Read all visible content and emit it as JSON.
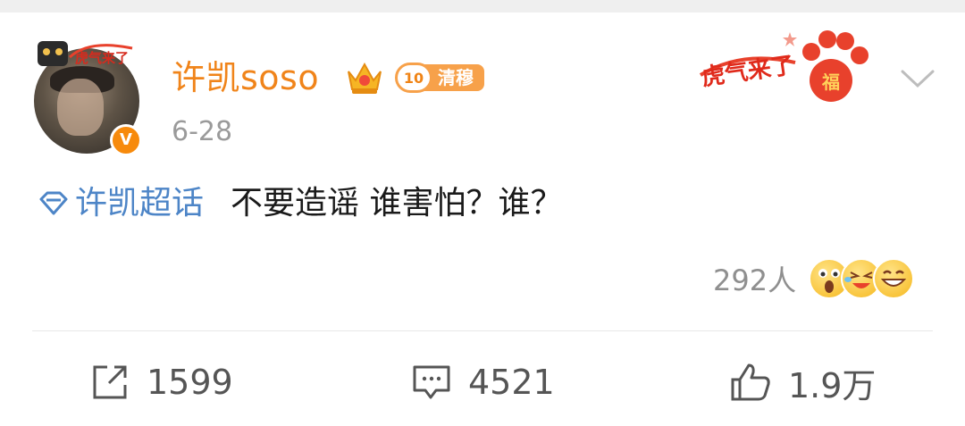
{
  "post": {
    "author": {
      "name": "许凯soso",
      "verified_mark": "V",
      "avatar_frame_text": "虎气来了",
      "crown_icon": "crown-icon",
      "fan_badge": {
        "level": "10",
        "name": "清穆"
      }
    },
    "date": "6-28",
    "content": {
      "topic_icon": "diamond-icon",
      "topic": "许凯超话",
      "text": "不要造谣 谁害怕？谁？"
    },
    "decoration": {
      "text": "虎气来了",
      "badge_char": "福"
    },
    "reactions": {
      "count": "292人",
      "emojis": [
        "surprised-emoji",
        "laugh-cry-emoji",
        "grin-emoji"
      ]
    },
    "actions": {
      "repost": {
        "icon": "share-icon",
        "count": "1599"
      },
      "comment": {
        "icon": "comment-icon",
        "count": "4521"
      },
      "like": {
        "icon": "thumbs-up-icon",
        "count": "1.9万"
      }
    }
  },
  "colors": {
    "username": "#f0841a",
    "topic": "#4d85c7",
    "muted": "#9a9a9a",
    "verify": "#f78a0c"
  }
}
